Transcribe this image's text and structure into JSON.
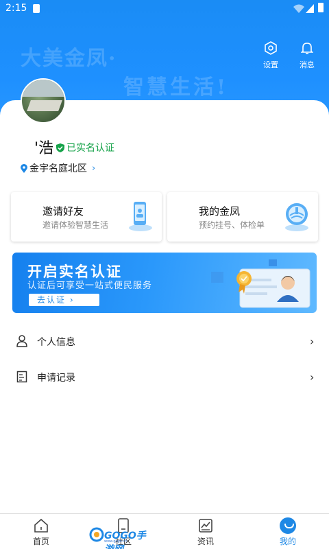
{
  "status_bar": {
    "time": "2:15"
  },
  "header": {
    "slogan_line1": "大美金凤·",
    "slogan_line2": "智慧生活!",
    "settings_label": "设置",
    "messages_label": "消息",
    "bg_color": "#1e90ff"
  },
  "profile": {
    "name": "'浩",
    "verified_label": "已实名认证",
    "location": "金宇名庭北区",
    "location_chevron": "›"
  },
  "quick_cards": [
    {
      "title": "邀请好友",
      "subtitle": "邀请体验智慧生活",
      "icon": "phone-contact-icon"
    },
    {
      "title": "我的金凤",
      "subtitle": "预约挂号、体检单",
      "icon": "jinfeng-logo-icon"
    }
  ],
  "banner": {
    "title": "开启实名认证",
    "subtitle": "认证后可享受一站式便民服务",
    "button_label": "去认证 ›"
  },
  "menu": [
    {
      "label": "个人信息",
      "icon": "user-icon"
    },
    {
      "label": "申请记录",
      "icon": "document-icon"
    }
  ],
  "bottom_nav": {
    "items": [
      {
        "label": "首页",
        "icon": "home-icon",
        "active": false
      },
      {
        "label": "社区",
        "icon": "community-icon",
        "active": false
      },
      {
        "label": "资讯",
        "icon": "news-icon",
        "active": false
      },
      {
        "label": "我的",
        "icon": "mine-icon",
        "active": true
      }
    ],
    "active_color": "#1e88e5"
  },
  "watermark": {
    "brand": "GOGO手游网",
    "domain": "www.gogo.cn"
  }
}
